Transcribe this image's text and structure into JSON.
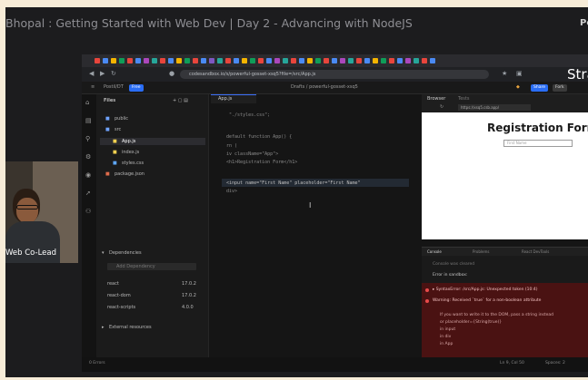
{
  "meeting": {
    "title": "Bhopal : Getting Started with Web Dev | Day 2 - Advancing with NodeJS",
    "top_right": "Pe",
    "participant_label": "Web Co-Lead"
  },
  "browser": {
    "brand_text": "Stra",
    "url": "codesandbox.io/s/powerful-gosset-xsq5?file=/src/App.js"
  },
  "codesandbox": {
    "project_name": "Postil/DT",
    "project_badge": "Free",
    "sandbox_name": "Drafts / powerful-gosset-xsq5",
    "share_label": "Share",
    "fork_label": "Fork",
    "sidebar_header": "Files",
    "files": [
      "public",
      "src",
      "App.js",
      "index.js",
      "styles.css",
      "package.json"
    ],
    "dependencies_header": "Dependencies",
    "dependency_search_placeholder": "Add Dependency",
    "dependencies": [
      "react",
      "react-dom",
      "react-scripts"
    ],
    "dependency_versions": [
      "17.0.2",
      "17.0.2",
      "4.0.0"
    ],
    "external_resources_header": "External resources",
    "editor_tab": "App.js",
    "code_lines": [
      "  \"./styles.css\";",
      "",
      " default function App() {",
      " rn (",
      " iv className=\"App\">",
      " <h1>Registration Form</h1>",
      "",
      "",
      " <input name=\"First Name\" placeholder=\"First Name\"",
      " div>"
    ],
    "browser_tab": "Browser",
    "tests_tab": "Tests",
    "preview_url": "https://xsq5.csb.app/",
    "preview": {
      "heading": "Registration Form",
      "input_placeholder": "First Name"
    },
    "console_tabs": [
      "Console",
      "Problems",
      "React DevTools"
    ],
    "console_lines": [
      "Console was cleared",
      "Error in sandbox:",
      "▸ SyntaxError: /src/App.js: Unexpected token (10:4)",
      "Warning: Received `true` for a non-boolean attribute",
      "If you want to write it to the DOM, pass a string instead",
      "or placeholder={String(true)}",
      "    in input",
      "    in div",
      "    in App"
    ],
    "status_left": "0 Errors",
    "status_right": "Ln 9, Col 50",
    "status_right2": "Spaces: 2"
  },
  "colors": {
    "page_bg": "#f7ecd8",
    "meet_bg": "#1c1c1e",
    "accent_blue": "#2a6df4",
    "error_red": "#e84b4b"
  }
}
